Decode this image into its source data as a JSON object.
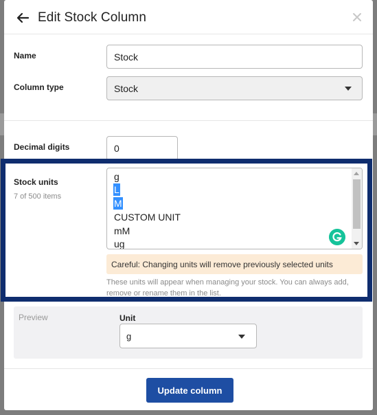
{
  "dialog": {
    "title": "Edit Stock Column"
  },
  "form": {
    "name_label": "Name",
    "name_value": "Stock",
    "column_type_label": "Column type",
    "column_type_value": "Stock",
    "decimal_digits_label": "Decimal digits",
    "decimal_digits_value": "0",
    "stock_units_label": "Stock units",
    "stock_units_count": "7 of 500 items",
    "stock_units": [
      {
        "label": "g",
        "selected": false
      },
      {
        "label": "L",
        "selected": true
      },
      {
        "label": "M",
        "selected": true
      },
      {
        "label": "CUSTOM UNIT",
        "selected": false
      },
      {
        "label": "mM",
        "selected": false
      },
      {
        "label": "ug",
        "selected": false
      }
    ],
    "warning_text": "Careful: Changing units will remove previously selected units",
    "help_text": "These units will appear when managing your stock. You can always add, remove or rename them in the list."
  },
  "preview": {
    "label": "Preview",
    "unit_label": "Unit",
    "unit_value": "g"
  },
  "footer": {
    "update_label": "Update column"
  },
  "colors": {
    "primary": "#1e4ea3",
    "highlight_border": "#0f2d6e",
    "selection": "#3390ff",
    "warning_bg": "#fcebd6"
  },
  "icons": [
    "back-arrow-icon",
    "close-icon",
    "chevron-down-icon",
    "grammarly-icon"
  ]
}
